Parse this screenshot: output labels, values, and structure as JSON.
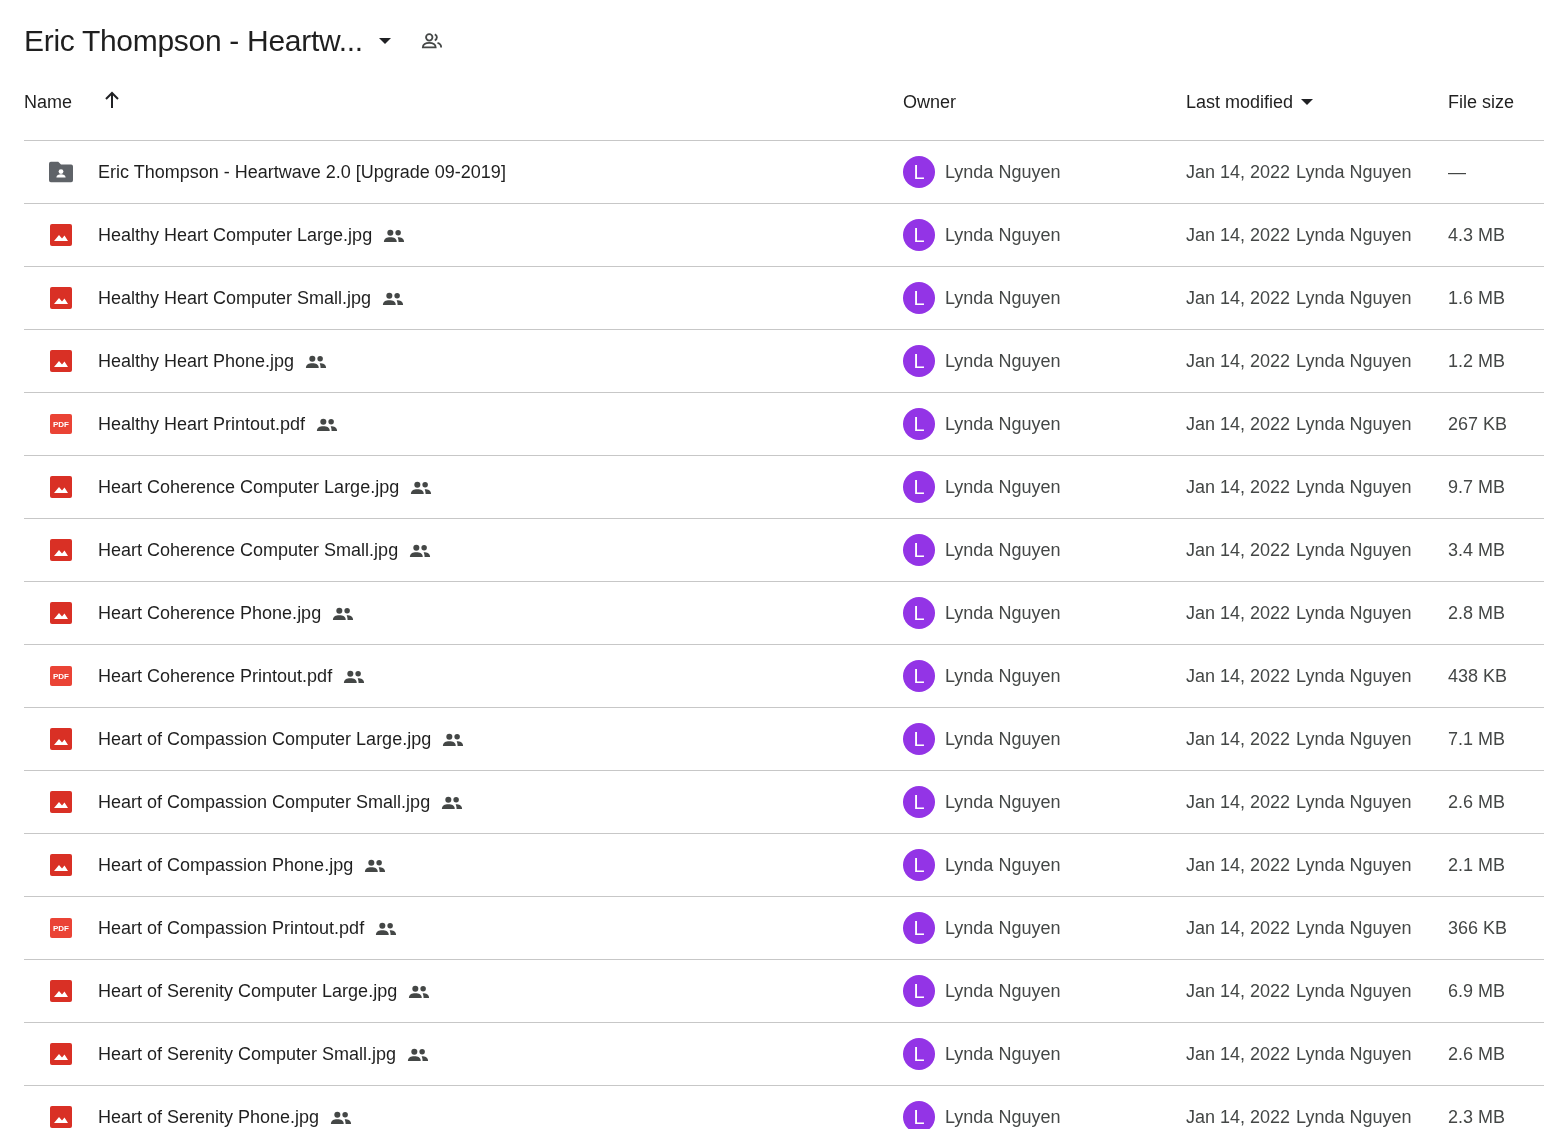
{
  "title": "Eric Thompson - Heartw...",
  "columns": {
    "name": "Name",
    "owner": "Owner",
    "modified": "Last modified",
    "size": "File size"
  },
  "rows": [
    {
      "kind": "folder",
      "name": "Eric Thompson - Heartwave 2.0 [Upgrade 09-2019]",
      "shared": false,
      "avatar": "L",
      "owner": "Lynda Nguyen",
      "date": "Jan 14, 2022",
      "modifier": "Lynda Nguyen",
      "size": "—"
    },
    {
      "kind": "image",
      "name": "Healthy Heart Computer Large.jpg",
      "shared": true,
      "avatar": "L",
      "owner": "Lynda Nguyen",
      "date": "Jan 14, 2022",
      "modifier": "Lynda Nguyen",
      "size": "4.3 MB"
    },
    {
      "kind": "image",
      "name": "Healthy Heart Computer Small.jpg",
      "shared": true,
      "avatar": "L",
      "owner": "Lynda Nguyen",
      "date": "Jan 14, 2022",
      "modifier": "Lynda Nguyen",
      "size": "1.6 MB"
    },
    {
      "kind": "image",
      "name": "Healthy Heart Phone.jpg",
      "shared": true,
      "avatar": "L",
      "owner": "Lynda Nguyen",
      "date": "Jan 14, 2022",
      "modifier": "Lynda Nguyen",
      "size": "1.2 MB"
    },
    {
      "kind": "pdf",
      "icon_text": "PDF",
      "name": "Healthy Heart Printout.pdf",
      "shared": true,
      "avatar": "L",
      "owner": "Lynda Nguyen",
      "date": "Jan 14, 2022",
      "modifier": "Lynda Nguyen",
      "size": "267 KB"
    },
    {
      "kind": "image",
      "name": "Heart Coherence Computer Large.jpg",
      "shared": true,
      "avatar": "L",
      "owner": "Lynda Nguyen",
      "date": "Jan 14, 2022",
      "modifier": "Lynda Nguyen",
      "size": "9.7 MB"
    },
    {
      "kind": "image",
      "name": "Heart Coherence Computer Small.jpg",
      "shared": true,
      "avatar": "L",
      "owner": "Lynda Nguyen",
      "date": "Jan 14, 2022",
      "modifier": "Lynda Nguyen",
      "size": "3.4 MB"
    },
    {
      "kind": "image",
      "name": "Heart Coherence Phone.jpg",
      "shared": true,
      "avatar": "L",
      "owner": "Lynda Nguyen",
      "date": "Jan 14, 2022",
      "modifier": "Lynda Nguyen",
      "size": "2.8 MB"
    },
    {
      "kind": "pdf",
      "icon_text": "PDF",
      "name": "Heart Coherence Printout.pdf",
      "shared": true,
      "avatar": "L",
      "owner": "Lynda Nguyen",
      "date": "Jan 14, 2022",
      "modifier": "Lynda Nguyen",
      "size": "438 KB"
    },
    {
      "kind": "image",
      "name": "Heart of Compassion Computer Large.jpg",
      "shared": true,
      "avatar": "L",
      "owner": "Lynda Nguyen",
      "date": "Jan 14, 2022",
      "modifier": "Lynda Nguyen",
      "size": "7.1 MB"
    },
    {
      "kind": "image",
      "name": "Heart of Compassion Computer Small.jpg",
      "shared": true,
      "avatar": "L",
      "owner": "Lynda Nguyen",
      "date": "Jan 14, 2022",
      "modifier": "Lynda Nguyen",
      "size": "2.6 MB"
    },
    {
      "kind": "image",
      "name": "Heart of Compassion Phone.jpg",
      "shared": true,
      "avatar": "L",
      "owner": "Lynda Nguyen",
      "date": "Jan 14, 2022",
      "modifier": "Lynda Nguyen",
      "size": "2.1 MB"
    },
    {
      "kind": "pdf",
      "icon_text": "PDF",
      "name": "Heart of Compassion Printout.pdf",
      "shared": true,
      "avatar": "L",
      "owner": "Lynda Nguyen",
      "date": "Jan 14, 2022",
      "modifier": "Lynda Nguyen",
      "size": "366 KB"
    },
    {
      "kind": "image",
      "name": "Heart of Serenity Computer Large.jpg",
      "shared": true,
      "avatar": "L",
      "owner": "Lynda Nguyen",
      "date": "Jan 14, 2022",
      "modifier": "Lynda Nguyen",
      "size": "6.9 MB"
    },
    {
      "kind": "image",
      "name": "Heart of Serenity Computer Small.jpg",
      "shared": true,
      "avatar": "L",
      "owner": "Lynda Nguyen",
      "date": "Jan 14, 2022",
      "modifier": "Lynda Nguyen",
      "size": "2.6 MB"
    },
    {
      "kind": "image",
      "name": "Heart of Serenity Phone.jpg",
      "shared": true,
      "avatar": "L",
      "owner": "Lynda Nguyen",
      "date": "Jan 14, 2022",
      "modifier": "Lynda Nguyen",
      "size": "2.3 MB"
    }
  ]
}
